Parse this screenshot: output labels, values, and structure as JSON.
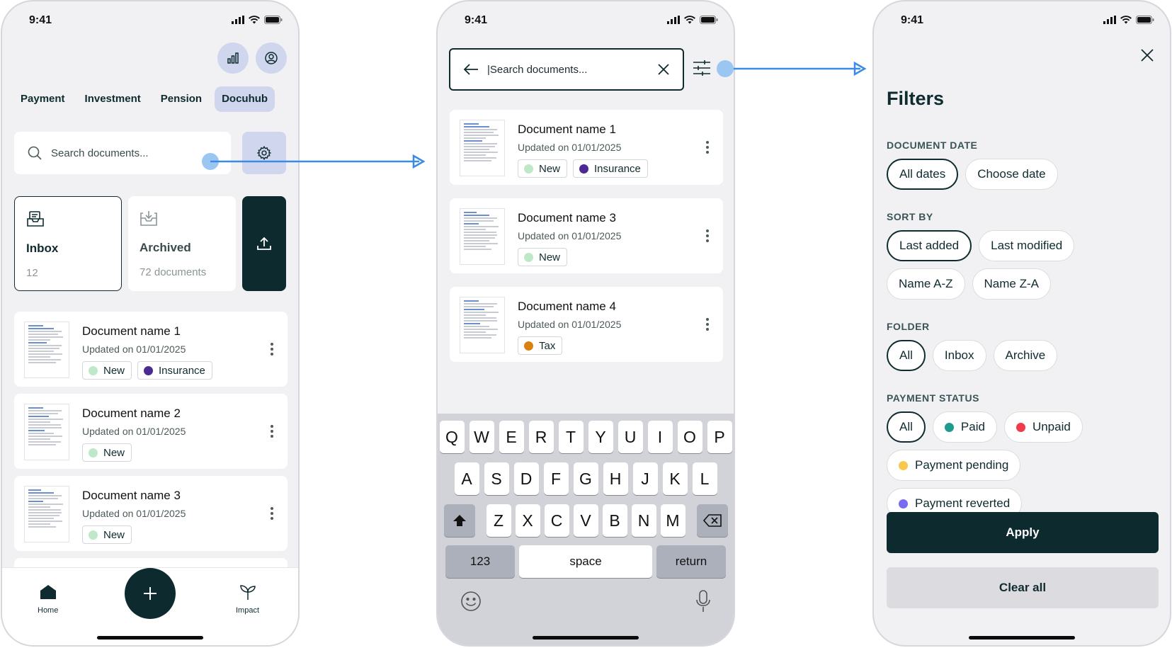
{
  "colors": {
    "primary_dark": "#0d2a2e",
    "accent_soft": "#cfd6ee",
    "flow_blue": "#3a8be6",
    "tag_new": "#bfe8c8",
    "tag_insurance": "#4b2a91",
    "tag_tax": "#d9800f",
    "status_paid": "#1e9b8c",
    "status_unpaid": "#f23b4a",
    "status_pending": "#f8c84a",
    "status_reverted": "#7a6cf0"
  },
  "status_bar": {
    "time": "9:41"
  },
  "screen1": {
    "tabs": [
      "Payment",
      "Investment",
      "Pension",
      "Docuhub"
    ],
    "active_tab": "Docuhub",
    "search_placeholder": "Search documents...",
    "folders": [
      {
        "name": "Inbox",
        "count": "12",
        "icon": "inbox-icon"
      },
      {
        "name": "Archived",
        "count": "72 documents",
        "icon": "archive-icon"
      }
    ],
    "documents": [
      {
        "title": "Document name 1",
        "date": "Updated on 01/01/2025",
        "tags": [
          {
            "label": "New",
            "color": "#bfe8c8"
          },
          {
            "label": "Insurance",
            "color": "#4b2a91"
          }
        ]
      },
      {
        "title": "Document name 2",
        "date": "Updated on 01/01/2025",
        "tags": [
          {
            "label": "New",
            "color": "#bfe8c8"
          }
        ]
      },
      {
        "title": "Document name 3",
        "date": "Updated on 01/01/2025",
        "tags": [
          {
            "label": "New",
            "color": "#bfe8c8"
          }
        ]
      }
    ],
    "nav": {
      "home": "Home",
      "impact": "Impact"
    }
  },
  "screen2": {
    "search_value": "|Search documents...",
    "documents": [
      {
        "title": "Document name 1",
        "date": "Updated on 01/01/2025",
        "tags": [
          {
            "label": "New",
            "color": "#bfe8c8"
          },
          {
            "label": "Insurance",
            "color": "#4b2a91"
          }
        ]
      },
      {
        "title": "Document name 3",
        "date": "Updated on 01/01/2025",
        "tags": [
          {
            "label": "New",
            "color": "#bfe8c8"
          }
        ]
      },
      {
        "title": "Document name 4",
        "date": "Updated on 01/01/2025",
        "tags": [
          {
            "label": "Tax",
            "color": "#d9800f"
          }
        ]
      }
    ],
    "keyboard": {
      "row1": [
        "Q",
        "W",
        "E",
        "R",
        "T",
        "Y",
        "U",
        "I",
        "O",
        "P"
      ],
      "row2": [
        "A",
        "S",
        "D",
        "F",
        "G",
        "H",
        "J",
        "K",
        "L"
      ],
      "row3": [
        "Z",
        "X",
        "C",
        "V",
        "B",
        "N",
        "M"
      ],
      "numbers": "123",
      "space": "space",
      "return": "return"
    }
  },
  "screen3": {
    "title": "Filters",
    "sections": {
      "document_date": {
        "label": "DOCUMENT DATE",
        "options": [
          "All dates",
          "Choose date"
        ],
        "selected": "All dates"
      },
      "sort_by": {
        "label": "SORT BY",
        "options": [
          "Last added",
          "Last modified",
          "Name A-Z",
          "Name Z-A"
        ],
        "selected": "Last added"
      },
      "folder": {
        "label": "FOLDER",
        "options": [
          "All",
          "Inbox",
          "Archive"
        ],
        "selected": "All"
      },
      "payment_status": {
        "label": "PAYMENT STATUS",
        "options": [
          "All",
          "Paid",
          "Unpaid",
          "Payment pending",
          "Payment reverted"
        ],
        "selected": "All"
      }
    },
    "apply": "Apply",
    "clear_all": "Clear all"
  }
}
